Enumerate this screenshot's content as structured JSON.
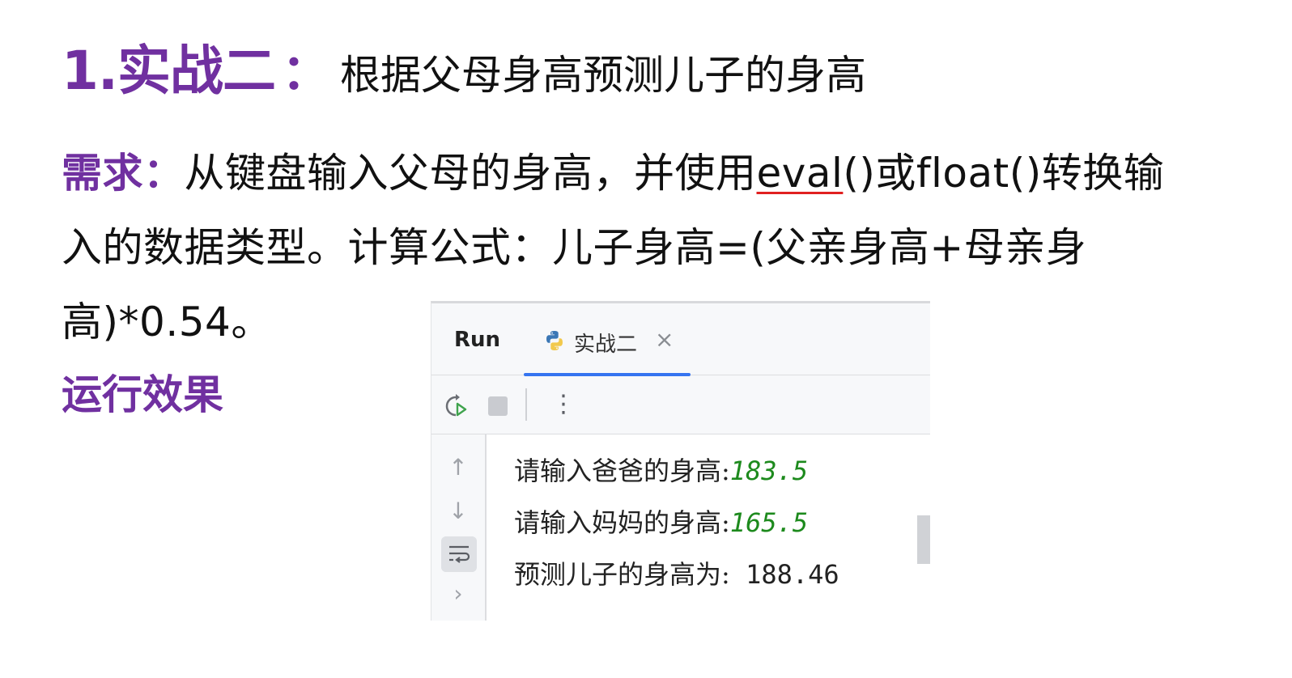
{
  "heading": {
    "main": "1.实战二",
    "colon": "：",
    "sub": "根据父母身高预测儿子的身高"
  },
  "requirement": {
    "label": "需求：",
    "text1": "从键盘输入父母的身高，并使用",
    "eval": "eval",
    "text2": "()或float()转换输入的数据类型。计算公式：儿子身高=(父亲身高+母亲身高)*0.54。"
  },
  "effect_label": "运行效果",
  "run_panel": {
    "run_label": "Run",
    "tab_label": "实战二",
    "close_glyph": "×",
    "console": [
      {
        "prompt": "请输入爸爸的身高:",
        "value": "183.5"
      },
      {
        "prompt": "请输入妈妈的身高:",
        "value": "165.5"
      },
      {
        "prompt": "预测儿子的身高为:",
        "value": " 188.46"
      }
    ],
    "icons": [
      "rerun-icon",
      "stop-icon",
      "more-icon",
      "scroll-up-icon",
      "scroll-down-icon",
      "soft-wrap-icon",
      "expand-icon",
      "python-icon"
    ],
    "colors": {
      "input_value": "#1d8a1d",
      "accent": "#3574f0",
      "heading": "#7030a0"
    }
  }
}
